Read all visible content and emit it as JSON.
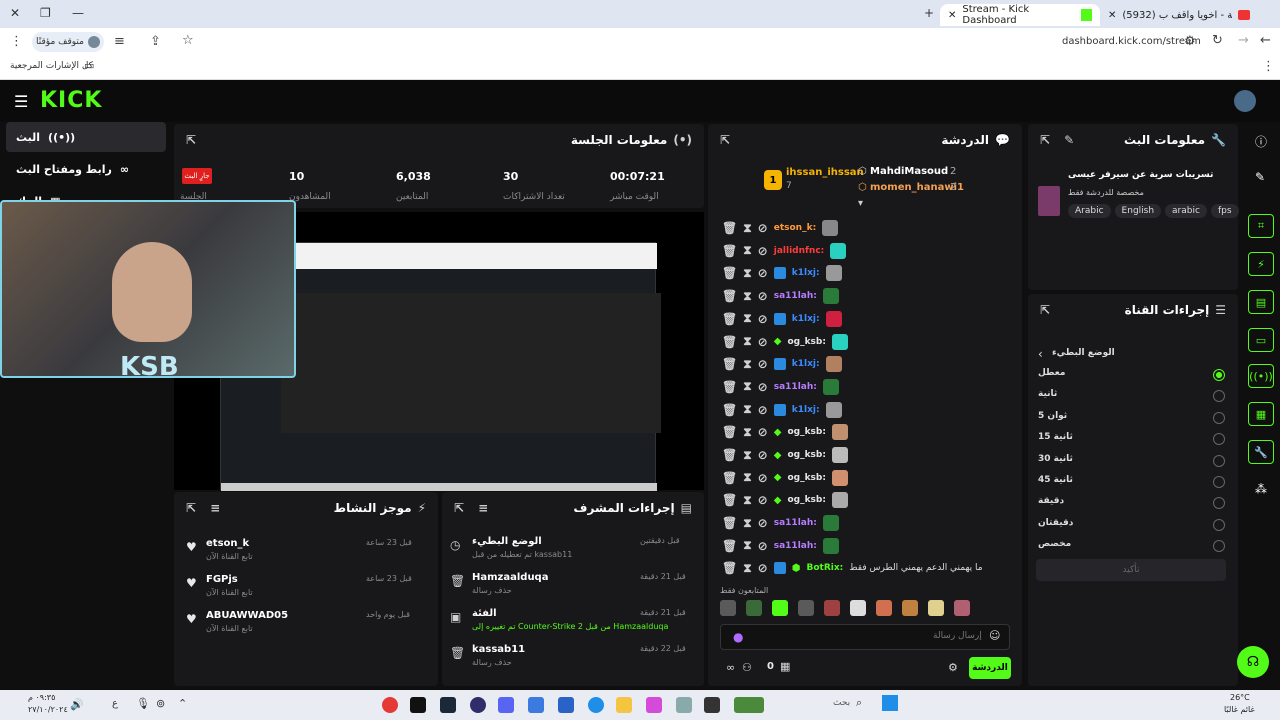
{
  "browser": {
    "tab_active": "Stream - Kick Dashboard",
    "tab_other": "(5932) ع دي راحة - اخويا واقف ب...",
    "url": "dashboard.kick.com/stream",
    "paused_label": "متوقف مؤقتًا",
    "bookmarks_label": "كل الإشارات المرجعية"
  },
  "nav": {
    "items": [
      "البث",
      "رابط ومفتاح البث",
      "الحك"
    ]
  },
  "session": {
    "title": "معلومات الجلسة",
    "live_badge": "جارٍ البث",
    "stats": [
      {
        "value": "00:07:21",
        "label": "الوقت مباشر"
      },
      {
        "value": "30",
        "label": "تعداد الاشتراكات"
      },
      {
        "value": "6,038",
        "label": "المتابعين"
      },
      {
        "value": "10",
        "label": "المشاهدون"
      }
    ],
    "session_label": "الجلسة"
  },
  "chat": {
    "title": "الدردشة",
    "leaders": [
      {
        "rank": "1",
        "name": "ihssan_ihssan",
        "count": "7"
      },
      {
        "name": "MahdiMasoud",
        "count": "2"
      },
      {
        "name": "momen_hanawi1",
        "count": "2"
      }
    ],
    "messages": [
      {
        "user": "etson_k:",
        "color": "#ff9a3c"
      },
      {
        "user": "jallidnfnc:",
        "color": "#ff3c3c"
      },
      {
        "user": "k1lxj:",
        "color": "#3c8cff"
      },
      {
        "user": "sa11lah:",
        "color": "#b87cff"
      },
      {
        "user": "k1lxj:",
        "color": "#3c8cff"
      },
      {
        "user": "og_ksb:",
        "color": "#e8e8e8"
      },
      {
        "user": "k1lxj:",
        "color": "#3c8cff"
      },
      {
        "user": "sa11lah:",
        "color": "#b87cff"
      },
      {
        "user": "k1lxj:",
        "color": "#3c8cff"
      },
      {
        "user": "og_ksb:",
        "color": "#e8e8e8"
      },
      {
        "user": "og_ksb:",
        "color": "#e8e8e8"
      },
      {
        "user": "og_ksb:",
        "color": "#e8e8e8"
      },
      {
        "user": "og_ksb:",
        "color": "#e8e8e8"
      },
      {
        "user": "sa11lah:",
        "color": "#b87cff"
      },
      {
        "user": "sa11lah:",
        "color": "#b87cff"
      }
    ],
    "bot_user": "BotRix:",
    "bot_msg": "ما يهمني الدعم يهمني الطرس فقط",
    "followers_only": "المتابعون فقط",
    "input_placeholder": "إرسال رسالة",
    "send_label": "الدردشة",
    "viewer_count": "0"
  },
  "stream_info": {
    "title": "معلومات البث",
    "stream_title": "تسريبات سرية عن سيرفر عيسى",
    "category": "مخصصة للدردشة فقط",
    "tags": [
      "Arabic",
      "English",
      "arabic",
      "fps"
    ]
  },
  "channel_actions": {
    "title": "إجراءات القناة",
    "slow_mode": "الوضع البطيء",
    "options": [
      "معطل",
      "ثانية",
      "ثوان 5",
      "ثانية 15",
      "ثانية 30",
      "ثانية 45",
      "دقيقة",
      "دقيقتان",
      "مخصص"
    ],
    "confirm": "تأكيد"
  },
  "activity": {
    "title": "موجز النشاط",
    "items": [
      {
        "name": "etson_k",
        "sub": "تابع القناة الآن",
        "time": "قبل 23 ساعة"
      },
      {
        "name": "FGPjs",
        "sub": "تابع القناة الآن",
        "time": "قبل 23 ساعة"
      },
      {
        "name": "ABUAWWAD05",
        "sub": "تابع القناة الآن",
        "time": "قبل يوم واحد"
      }
    ]
  },
  "mod_actions": {
    "title": "إجراءات المشرف",
    "items": [
      {
        "name": "الوضع البطيء",
        "sub": "تم تعطيله من قبل kassab11",
        "time": "قبل دقيقتين"
      },
      {
        "name": "Hamzaalduqa",
        "sub": "حذف رسالة",
        "time": "قبل 21 دقيقة"
      },
      {
        "name": "الفئة",
        "sub": "تم تغييره إلى Counter-Strike 2 من قبل Hamzaalduqa",
        "time": "قبل 21 دقيقة"
      },
      {
        "name": "kassab11",
        "sub": "حذف رسالة",
        "time": "قبل 22 دقيقة"
      }
    ]
  },
  "taskbar": {
    "search": "بحث",
    "weather_temp": "26°C",
    "weather_text": "غائم غالبًا",
    "time": "٠٩:٣٥ م",
    "date": "٢٧/١٠/٢٠٢٤"
  },
  "colors": {
    "accent": "#53fc18",
    "panel": "#18181b",
    "live": "#e0201e"
  }
}
